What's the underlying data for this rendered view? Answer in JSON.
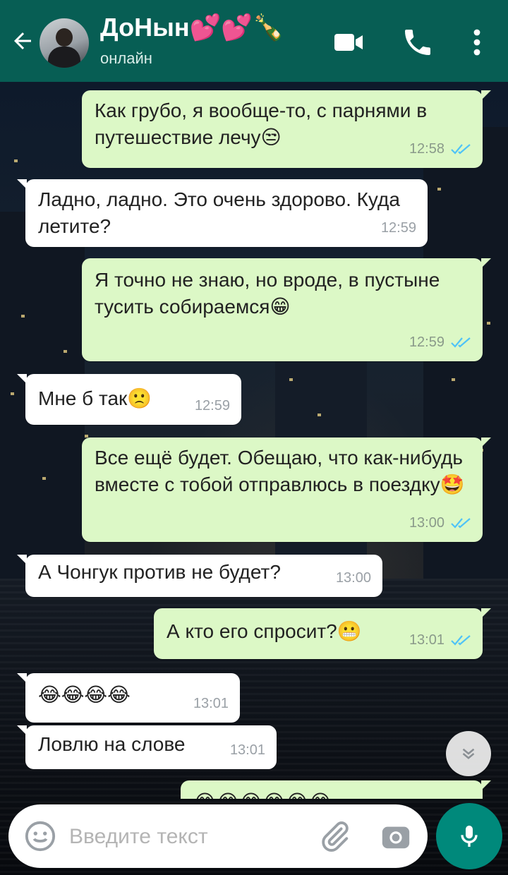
{
  "header": {
    "contact_name": "ДоНын💕💕🍾",
    "status": "онлайн",
    "icons": [
      "back-arrow-icon",
      "video-call-icon",
      "phone-icon",
      "more-vert-icon"
    ]
  },
  "messages": [
    {
      "dir": "out",
      "text": "Как грубо, я вообще-то, с парнями в путешествие лечу😒",
      "time": "12:58",
      "read": true
    },
    {
      "dir": "in",
      "text": "Ладно, ладно. Это очень здорово. Куда летите?",
      "time": "12:59"
    },
    {
      "dir": "out",
      "text": "Я точно не знаю, но вроде, в пустыне тусить собираемся😁",
      "time": "12:59",
      "read": true
    },
    {
      "dir": "in",
      "text": "Мне б так🙁",
      "time": "12:59"
    },
    {
      "dir": "out",
      "text": "Все ещё будет. Обещаю, что как-нибудь вместе с тобой отправлюсь в поездку🤩",
      "time": "13:00",
      "read": true
    },
    {
      "dir": "in",
      "text": "А Чонгук против не будет?",
      "time": "13:00"
    },
    {
      "dir": "out",
      "text": "А кто его спросит?😬",
      "time": "13:01",
      "read": true
    },
    {
      "dir": "in",
      "text": "😂😂😂😂",
      "time": "13:01"
    },
    {
      "dir": "in",
      "text": "Ловлю на слове",
      "time": "13:01"
    },
    {
      "dir": "out",
      "text": "😂😂😂😂😂😂",
      "time": ""
    }
  ],
  "composer": {
    "placeholder": "Введите текст",
    "icons": [
      "emoji-icon",
      "attach-icon",
      "camera-icon",
      "mic-icon"
    ]
  },
  "colors": {
    "header": "#075e54",
    "outgoing_bubble": "#dcf8c6",
    "incoming_bubble": "#ffffff",
    "read_ticks": "#4fc3f7",
    "mic_button": "#00897b"
  }
}
